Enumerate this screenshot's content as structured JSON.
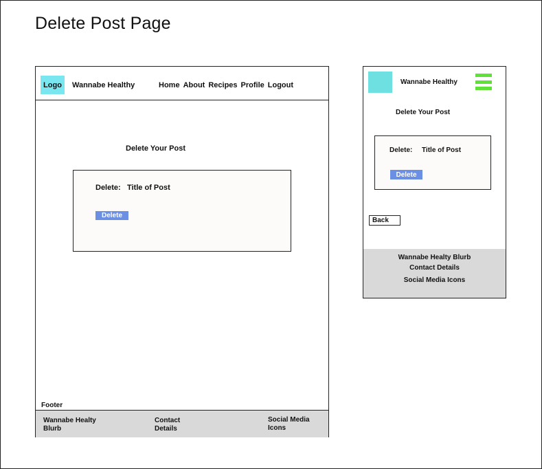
{
  "page": {
    "title": "Delete Post Page"
  },
  "desktop": {
    "header": {
      "logo": "Logo",
      "brand": "Wannabe Healthy",
      "nav": [
        "Home",
        "About",
        "Recipes",
        "Profile",
        "Logout"
      ]
    },
    "heading": "Delete Your Post",
    "card": {
      "delete_label": "Delete:",
      "post_title": "Title of Post",
      "delete_button": "Delete"
    },
    "footer_label": "Footer",
    "footer": {
      "blurb": "Wannabe Healty Blurb",
      "contact": "Contact Details",
      "social": "Social Media Icons"
    }
  },
  "mobile": {
    "header": {
      "brand": "Wannabe Healthy",
      "menu_icon": "hamburger-menu-icon"
    },
    "heading": "Delete Your Post",
    "card": {
      "delete_label": "Delete:",
      "post_title": "Title of Post",
      "delete_button": "Delete"
    },
    "back_button": "Back",
    "footer": {
      "blurb": "Wannabe Healty Blurb",
      "contact": "Contact Details",
      "social": "Social Media Icons"
    }
  },
  "colors": {
    "logo_fill": "#7ae6ef",
    "button_fill": "#6b8fe3",
    "menu_icon": "#5fe13a",
    "footer_fill": "#d9d9d9"
  }
}
